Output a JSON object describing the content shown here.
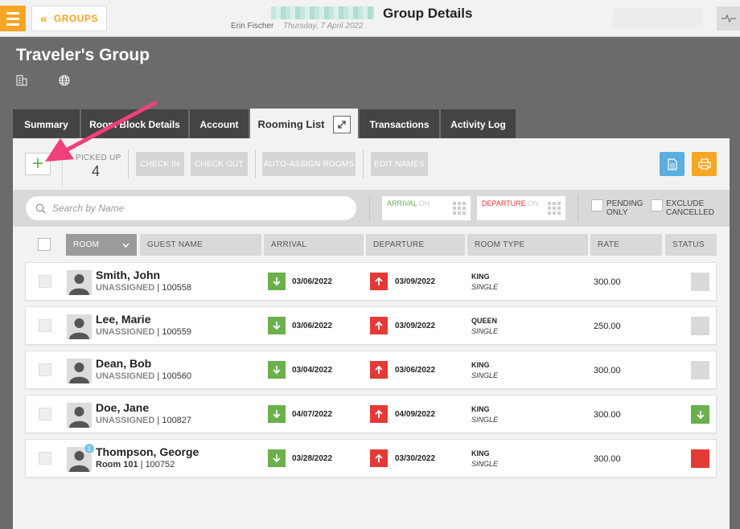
{
  "topbar": {
    "back_label": "GROUPS",
    "title": "Group Details",
    "user": "Erin Fischer",
    "date": "Thursday, 7 April 2022"
  },
  "group": {
    "name": "Traveler's Group"
  },
  "tabs": [
    {
      "label": "Summary",
      "active": false
    },
    {
      "label": "Room Block Details",
      "active": false
    },
    {
      "label": "Account",
      "active": false
    },
    {
      "label": "Rooming List",
      "active": true
    },
    {
      "label": "Transactions",
      "active": false
    },
    {
      "label": "Activity Log",
      "active": false
    }
  ],
  "toolbar": {
    "picked_up_label": "PICKED UP",
    "picked_up_count": "4",
    "check_in": "CHECK IN",
    "check_out": "CHECK OUT",
    "auto_assign": "AUTO-ASSIGN ROOMS",
    "edit_names": "EDIT NAMES"
  },
  "filters": {
    "search_placeholder": "Search by Name",
    "arrival_label": "ARRIVAL",
    "arrival_on": "ON",
    "departure_label": "DEPARTURE",
    "departure_on": "ON",
    "pending_line1": "PENDING",
    "pending_line2": "ONLY",
    "exclude_line1": "EXCLUDE",
    "exclude_line2": "CANCELLED"
  },
  "table": {
    "columns": {
      "room": "ROOM",
      "guest_name": "GUEST NAME",
      "arrival": "ARRIVAL",
      "departure": "DEPARTURE",
      "room_type": "ROOM TYPE",
      "rate": "RATE",
      "status": "STATUS"
    },
    "rows": [
      {
        "name": "Smith, John",
        "room": "UNASSIGNED",
        "id": "100558",
        "arrival": "03/06/2022",
        "departure": "03/09/2022",
        "type": "KING",
        "bed": "SINGLE",
        "rate": "300.00",
        "status": "gray",
        "badge": ""
      },
      {
        "name": "Lee, Marie",
        "room": "UNASSIGNED",
        "id": "100559",
        "arrival": "03/06/2022",
        "departure": "03/09/2022",
        "type": "QUEEN",
        "bed": "SINGLE",
        "rate": "250.00",
        "status": "gray",
        "badge": ""
      },
      {
        "name": "Dean, Bob",
        "room": "UNASSIGNED",
        "id": "100560",
        "arrival": "03/04/2022",
        "departure": "03/06/2022",
        "type": "KING",
        "bed": "SINGLE",
        "rate": "300.00",
        "status": "gray",
        "badge": ""
      },
      {
        "name": "Doe, Jane",
        "room": "UNASSIGNED",
        "id": "100827",
        "arrival": "04/07/2022",
        "departure": "04/09/2022",
        "type": "KING",
        "bed": "SINGLE",
        "rate": "300.00",
        "status": "green",
        "badge": ""
      },
      {
        "name": "Thompson, George",
        "room": "Room 101",
        "id": "100752",
        "arrival": "03/28/2022",
        "departure": "03/30/2022",
        "type": "KING",
        "bed": "SINGLE",
        "rate": "300.00",
        "status": "red",
        "badge": "1"
      }
    ]
  },
  "colors": {
    "accent": "#f5a623",
    "green": "#6ab04c",
    "red": "#e53935",
    "blue": "#5aaee0",
    "annotation": "#f0407a"
  }
}
